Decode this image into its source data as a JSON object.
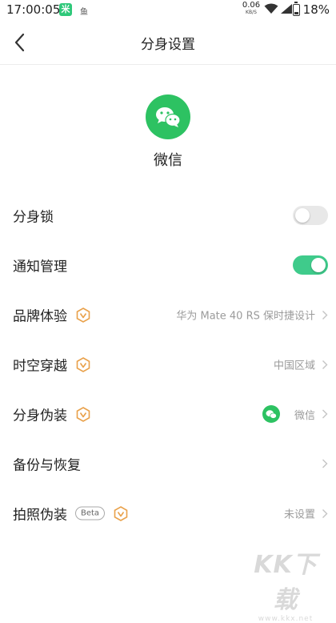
{
  "status_bar": {
    "time": "17:00:05",
    "app_badge": "米",
    "app_small": "鱼",
    "net_speed": "0.06",
    "net_unit": "KB/S",
    "battery": "18%"
  },
  "header": {
    "title": "分身设置"
  },
  "app": {
    "name": "微信",
    "icon": "wechat-icon",
    "brand_color": "#2dc262"
  },
  "settings": {
    "clone_lock": {
      "label": "分身锁",
      "enabled": false
    },
    "notification": {
      "label": "通知管理",
      "enabled": true
    },
    "brand_experience": {
      "label": "品牌体验",
      "value": "华为 Mate 40 RS 保时捷设计"
    },
    "time_travel": {
      "label": "时空穿越",
      "value": "中国区域"
    },
    "disguise": {
      "label": "分身伪装",
      "value": "微信"
    },
    "backup": {
      "label": "备份与恢复"
    },
    "photo_disguise": {
      "label": "拍照伪装",
      "badge": "Beta",
      "value": "未设置"
    }
  },
  "colors": {
    "toggle_on": "#3fcb8b",
    "toggle_off": "#e8e8e8",
    "vip_badge": "#e9a14a"
  },
  "watermark": {
    "text": "KK下载",
    "url": "www.kkx.net"
  }
}
